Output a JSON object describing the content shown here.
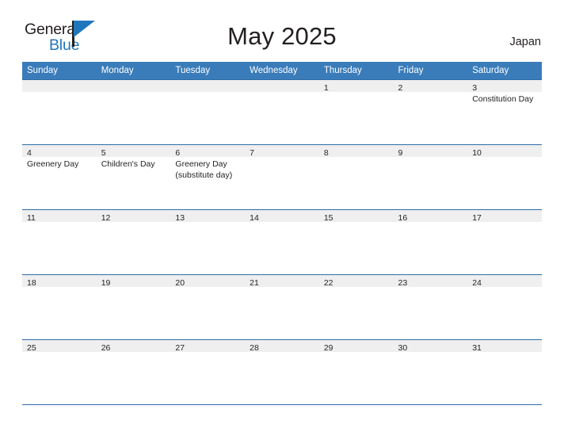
{
  "brand": {
    "line1": "General",
    "line2": "Blue",
    "logo_icon": "triangle-logo-icon",
    "accent_color": "#1f76bc"
  },
  "header": {
    "title": "May 2025",
    "country": "Japan"
  },
  "theme": {
    "header_blue": "#3a7cb9",
    "rule_blue": "#2d6ca6",
    "cell_head_gray": "#efefef",
    "text_color": "#231f20"
  },
  "calendar": {
    "weekdays": [
      "Sunday",
      "Monday",
      "Tuesday",
      "Wednesday",
      "Thursday",
      "Friday",
      "Saturday"
    ],
    "month": "May",
    "year": "2025",
    "weeks": [
      [
        {
          "date": "",
          "holidays": []
        },
        {
          "date": "",
          "holidays": []
        },
        {
          "date": "",
          "holidays": []
        },
        {
          "date": "",
          "holidays": []
        },
        {
          "date": "1",
          "holidays": []
        },
        {
          "date": "2",
          "holidays": []
        },
        {
          "date": "3",
          "holidays": [
            "Constitution Day"
          ]
        }
      ],
      [
        {
          "date": "4",
          "holidays": [
            "Greenery Day"
          ]
        },
        {
          "date": "5",
          "holidays": [
            "Children's Day"
          ]
        },
        {
          "date": "6",
          "holidays": [
            "Greenery Day",
            "(substitute day)"
          ]
        },
        {
          "date": "7",
          "holidays": []
        },
        {
          "date": "8",
          "holidays": []
        },
        {
          "date": "9",
          "holidays": []
        },
        {
          "date": "10",
          "holidays": []
        }
      ],
      [
        {
          "date": "11",
          "holidays": []
        },
        {
          "date": "12",
          "holidays": []
        },
        {
          "date": "13",
          "holidays": []
        },
        {
          "date": "14",
          "holidays": []
        },
        {
          "date": "15",
          "holidays": []
        },
        {
          "date": "16",
          "holidays": []
        },
        {
          "date": "17",
          "holidays": []
        }
      ],
      [
        {
          "date": "18",
          "holidays": []
        },
        {
          "date": "19",
          "holidays": []
        },
        {
          "date": "20",
          "holidays": []
        },
        {
          "date": "21",
          "holidays": []
        },
        {
          "date": "22",
          "holidays": []
        },
        {
          "date": "23",
          "holidays": []
        },
        {
          "date": "24",
          "holidays": []
        }
      ],
      [
        {
          "date": "25",
          "holidays": []
        },
        {
          "date": "26",
          "holidays": []
        },
        {
          "date": "27",
          "holidays": []
        },
        {
          "date": "28",
          "holidays": []
        },
        {
          "date": "29",
          "holidays": []
        },
        {
          "date": "30",
          "holidays": []
        },
        {
          "date": "31",
          "holidays": []
        }
      ]
    ]
  }
}
